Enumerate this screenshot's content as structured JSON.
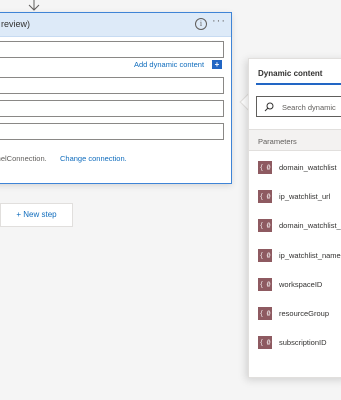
{
  "card": {
    "title": "review)",
    "info_glyph": "i",
    "more_glyph": "···",
    "add_dynamic_label": "Add dynamic content",
    "add_dynamic_glyph": "+",
    "connection_text": "inelConnection.",
    "change_connection": "Change connection."
  },
  "new_step": {
    "label": "+ New step"
  },
  "panel": {
    "tab": "Dynamic content",
    "search_placeholder": "Search dynamic",
    "section": "Parameters",
    "icon_glyph": "{ @ }",
    "params": [
      {
        "label": "domain_watchlist"
      },
      {
        "label": "ip_watchlist_url"
      },
      {
        "label": "domain_watchlist_"
      },
      {
        "label": "ip_watchlist_name"
      },
      {
        "label": "workspaceID"
      },
      {
        "label": "resourceGroup"
      },
      {
        "label": "subscriptionID"
      }
    ]
  },
  "colors": {
    "accent": "#2266c4",
    "link": "#0f6cbd",
    "param_icon": "#8e5a61",
    "card_border": "#3f84d6",
    "card_header": "#ddeaf8"
  },
  "icons": [
    "down-arrow-icon",
    "info-icon",
    "more-icon",
    "add-icon",
    "search-icon",
    "parameter-icon"
  ]
}
